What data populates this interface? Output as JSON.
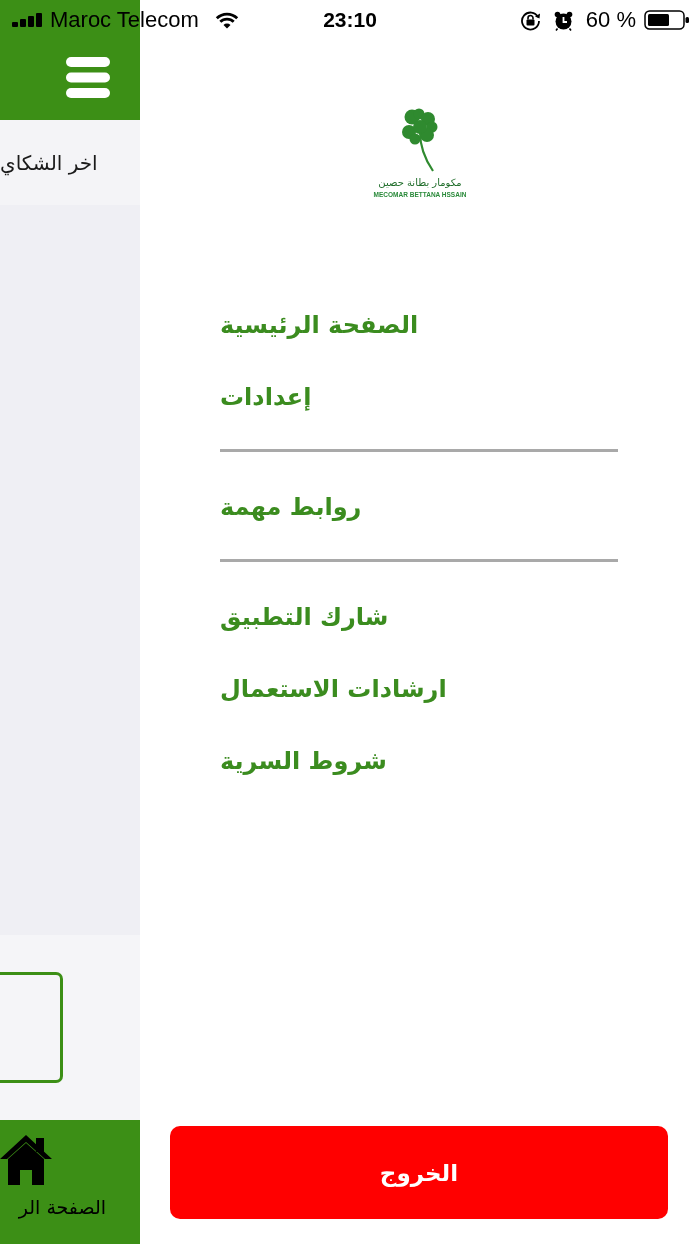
{
  "status_bar": {
    "carrier": "Maroc Telecom",
    "time": "23:10",
    "battery": "60 %"
  },
  "background_screen": {
    "list_item": "اخر الشكاي",
    "tab_bar": [
      {
        "label": "الصفحة الر"
      }
    ]
  },
  "drawer": {
    "logo": {
      "arabic_name": "مكومار بطانة حصين",
      "latin_name": "MECOMAR BETTANA HSSAIN"
    },
    "sections": [
      {
        "items": [
          {
            "label": "الصفحة الرئيسية"
          },
          {
            "label": "إعدادات"
          }
        ]
      },
      {
        "items": [
          {
            "label": "روابط مهمة"
          }
        ]
      },
      {
        "items": [
          {
            "label": "شارك التطبيق"
          },
          {
            "label": "ارشادات الاستعمال"
          },
          {
            "label": "شروط السرية"
          }
        ]
      }
    ],
    "logout_button": "الخروج"
  }
}
